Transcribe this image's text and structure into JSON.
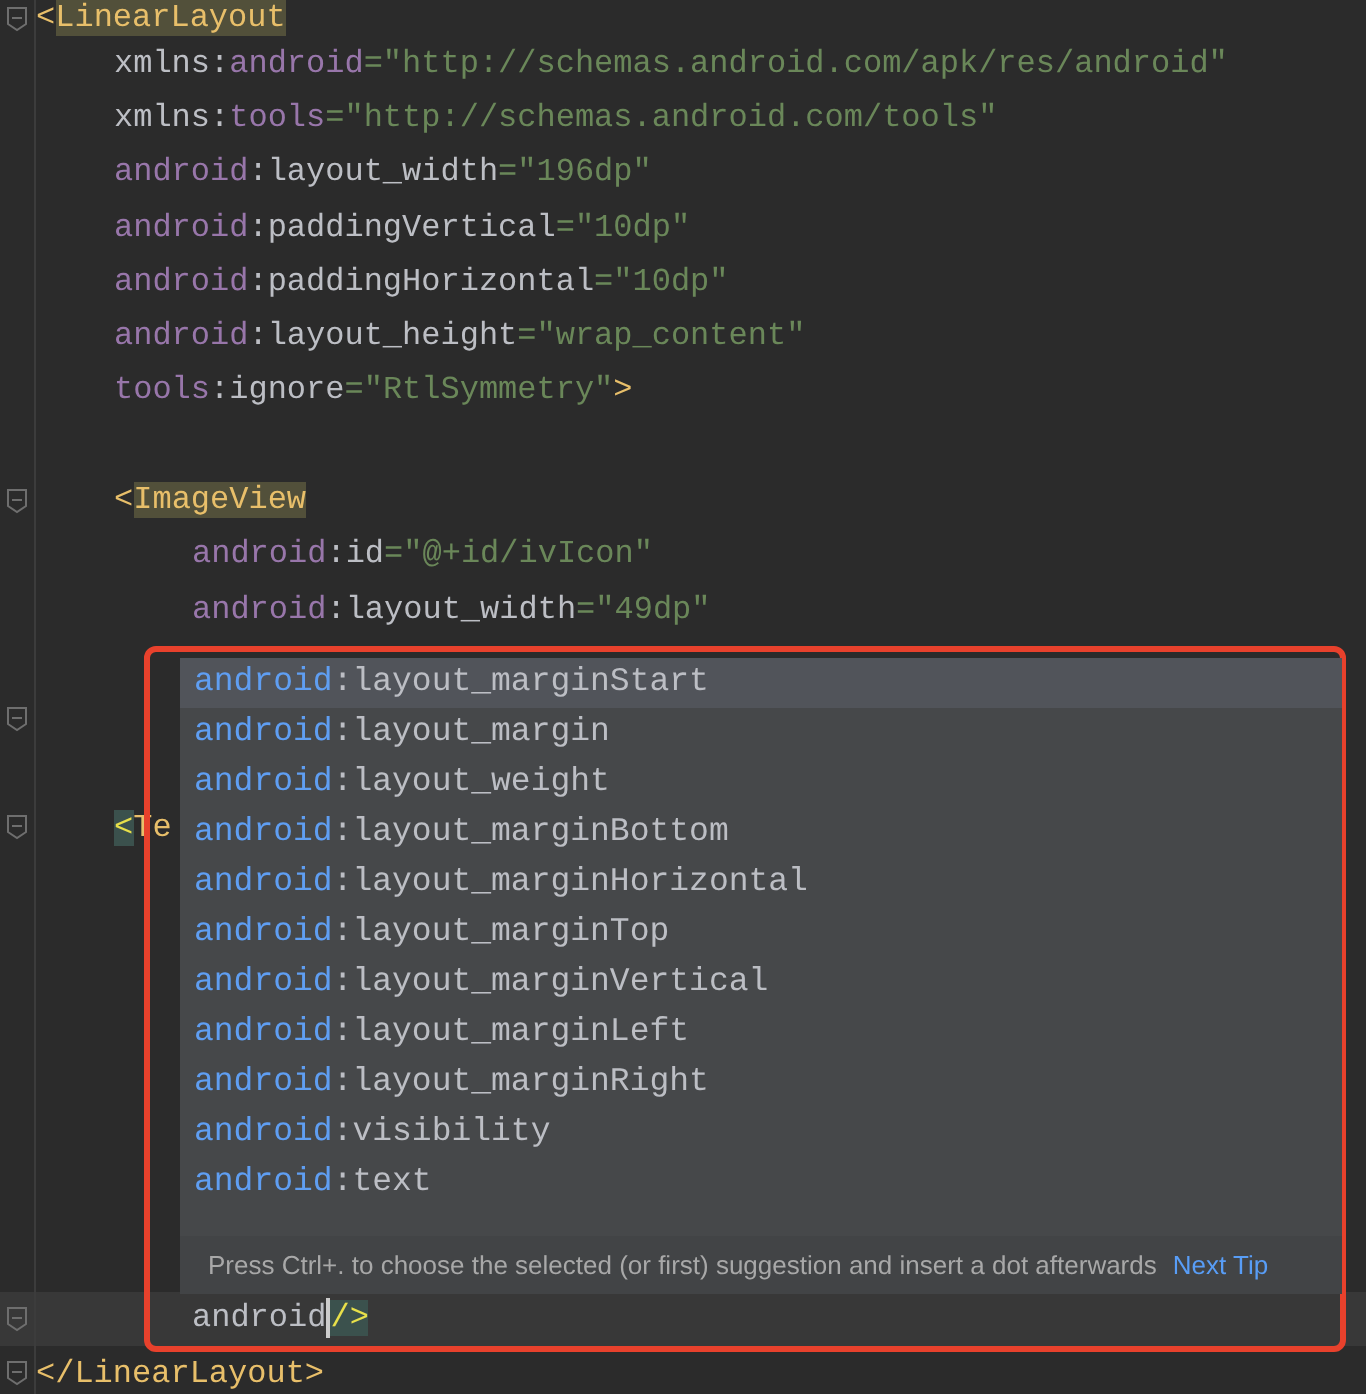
{
  "code_lines": [
    {
      "fold": true,
      "kind": "top",
      "tokens": [
        {
          "kind": "tag",
          "text": "<"
        },
        {
          "kind": "tag-hl",
          "text": "LinearLayout"
        }
      ]
    },
    {
      "fold": false,
      "kind": "attr",
      "tokens": [
        {
          "kind": "plain",
          "text": "xmlns:"
        },
        {
          "kind": "ns",
          "text": "android"
        },
        {
          "kind": "value",
          "text": "=\"http://schemas.android.com/apk/res/android\""
        }
      ]
    },
    {
      "fold": false,
      "kind": "attr",
      "tokens": [
        {
          "kind": "plain",
          "text": "xmlns:"
        },
        {
          "kind": "ns",
          "text": "tools"
        },
        {
          "kind": "value",
          "text": "=\"http://schemas.android.com/tools\""
        }
      ]
    },
    {
      "fold": false,
      "kind": "attr",
      "tokens": [
        {
          "kind": "ns",
          "text": "android"
        },
        {
          "kind": "plain",
          "text": ":layout_width"
        },
        {
          "kind": "value",
          "text": "=\"196dp\""
        }
      ]
    },
    {
      "fold": false,
      "kind": "attr",
      "tokens": [
        {
          "kind": "ns",
          "text": "android"
        },
        {
          "kind": "plain",
          "text": ":paddingVertical"
        },
        {
          "kind": "value",
          "text": "=\"10dp\""
        }
      ]
    },
    {
      "fold": false,
      "kind": "attr",
      "tokens": [
        {
          "kind": "ns",
          "text": "android"
        },
        {
          "kind": "plain",
          "text": ":paddingHorizontal"
        },
        {
          "kind": "value",
          "text": "=\"10dp\""
        }
      ]
    },
    {
      "fold": false,
      "kind": "attr",
      "tokens": [
        {
          "kind": "ns",
          "text": "android"
        },
        {
          "kind": "plain",
          "text": ":layout_height"
        },
        {
          "kind": "value",
          "text": "=\"wrap_content\""
        }
      ]
    },
    {
      "fold": false,
      "kind": "attr",
      "tokens": [
        {
          "kind": "ns",
          "text": "tools"
        },
        {
          "kind": "plain",
          "text": ":ignore"
        },
        {
          "kind": "value",
          "text": "=\"RtlSymmetry\""
        },
        {
          "kind": "tag",
          "text": ">"
        }
      ]
    },
    {
      "fold": false
    },
    {
      "fold": true,
      "kind": "attr",
      "tokens": [
        {
          "kind": "tag",
          "text": "<"
        },
        {
          "kind": "tag-hl",
          "text": "ImageView"
        }
      ]
    },
    {
      "fold": false,
      "kind": "nested-attr",
      "tokens": [
        {
          "kind": "ns",
          "text": "android"
        },
        {
          "kind": "plain",
          "text": ":id"
        },
        {
          "kind": "value",
          "text": "=\"@+id/ivIcon\""
        }
      ]
    },
    {
      "fold": false,
      "kind": "nested-attr",
      "tokens": [
        {
          "kind": "ns",
          "text": "android"
        },
        {
          "kind": "plain",
          "text": ":layout_width"
        },
        {
          "kind": "value",
          "text": "=\"49dp\""
        }
      ]
    },
    {
      "fold": false
    },
    {
      "fold": true
    },
    {
      "fold": false
    },
    {
      "fold": true,
      "kind": "attr",
      "tokens": [
        {
          "kind": "tag-match",
          "text": "<"
        },
        {
          "kind": "tag",
          "text": "Te"
        }
      ]
    },
    {
      "fold": false
    },
    {
      "fold": false
    },
    {
      "fold": false
    },
    {
      "fold": false
    },
    {
      "fold": false
    },
    {
      "fold": false
    },
    {
      "fold": false
    },
    {
      "fold": false
    },
    {
      "fold": true,
      "current": true,
      "kind": "nested-attr",
      "tokens": [
        {
          "kind": "plain",
          "text": "android"
        },
        {
          "kind": "caret"
        },
        {
          "kind": "tag-match",
          "text": "/>"
        }
      ]
    },
    {
      "fold": true,
      "kind": "top",
      "tokens": [
        {
          "kind": "tag",
          "text": "</LinearLayout>"
        }
      ]
    }
  ],
  "completion_popup": {
    "items": [
      {
        "namespace": "android",
        "attribute": ":layout_marginStart",
        "selected": true
      },
      {
        "namespace": "android",
        "attribute": ":layout_margin",
        "selected": false
      },
      {
        "namespace": "android",
        "attribute": ":layout_weight",
        "selected": false
      },
      {
        "namespace": "android",
        "attribute": ":layout_marginBottom",
        "selected": false
      },
      {
        "namespace": "android",
        "attribute": ":layout_marginHorizontal",
        "selected": false
      },
      {
        "namespace": "android",
        "attribute": ":layout_marginTop",
        "selected": false
      },
      {
        "namespace": "android",
        "attribute": ":layout_marginVertical",
        "selected": false
      },
      {
        "namespace": "android",
        "attribute": ":layout_marginLeft",
        "selected": false
      },
      {
        "namespace": "android",
        "attribute": ":layout_marginRight",
        "selected": false
      },
      {
        "namespace": "android",
        "attribute": ":visibility",
        "selected": false
      },
      {
        "namespace": "android",
        "attribute": ":text",
        "selected": false
      }
    ],
    "tip": "Press Ctrl+. to choose the selected (or first) suggestion and insert a dot afterwards",
    "tip_link": "Next Tip"
  }
}
